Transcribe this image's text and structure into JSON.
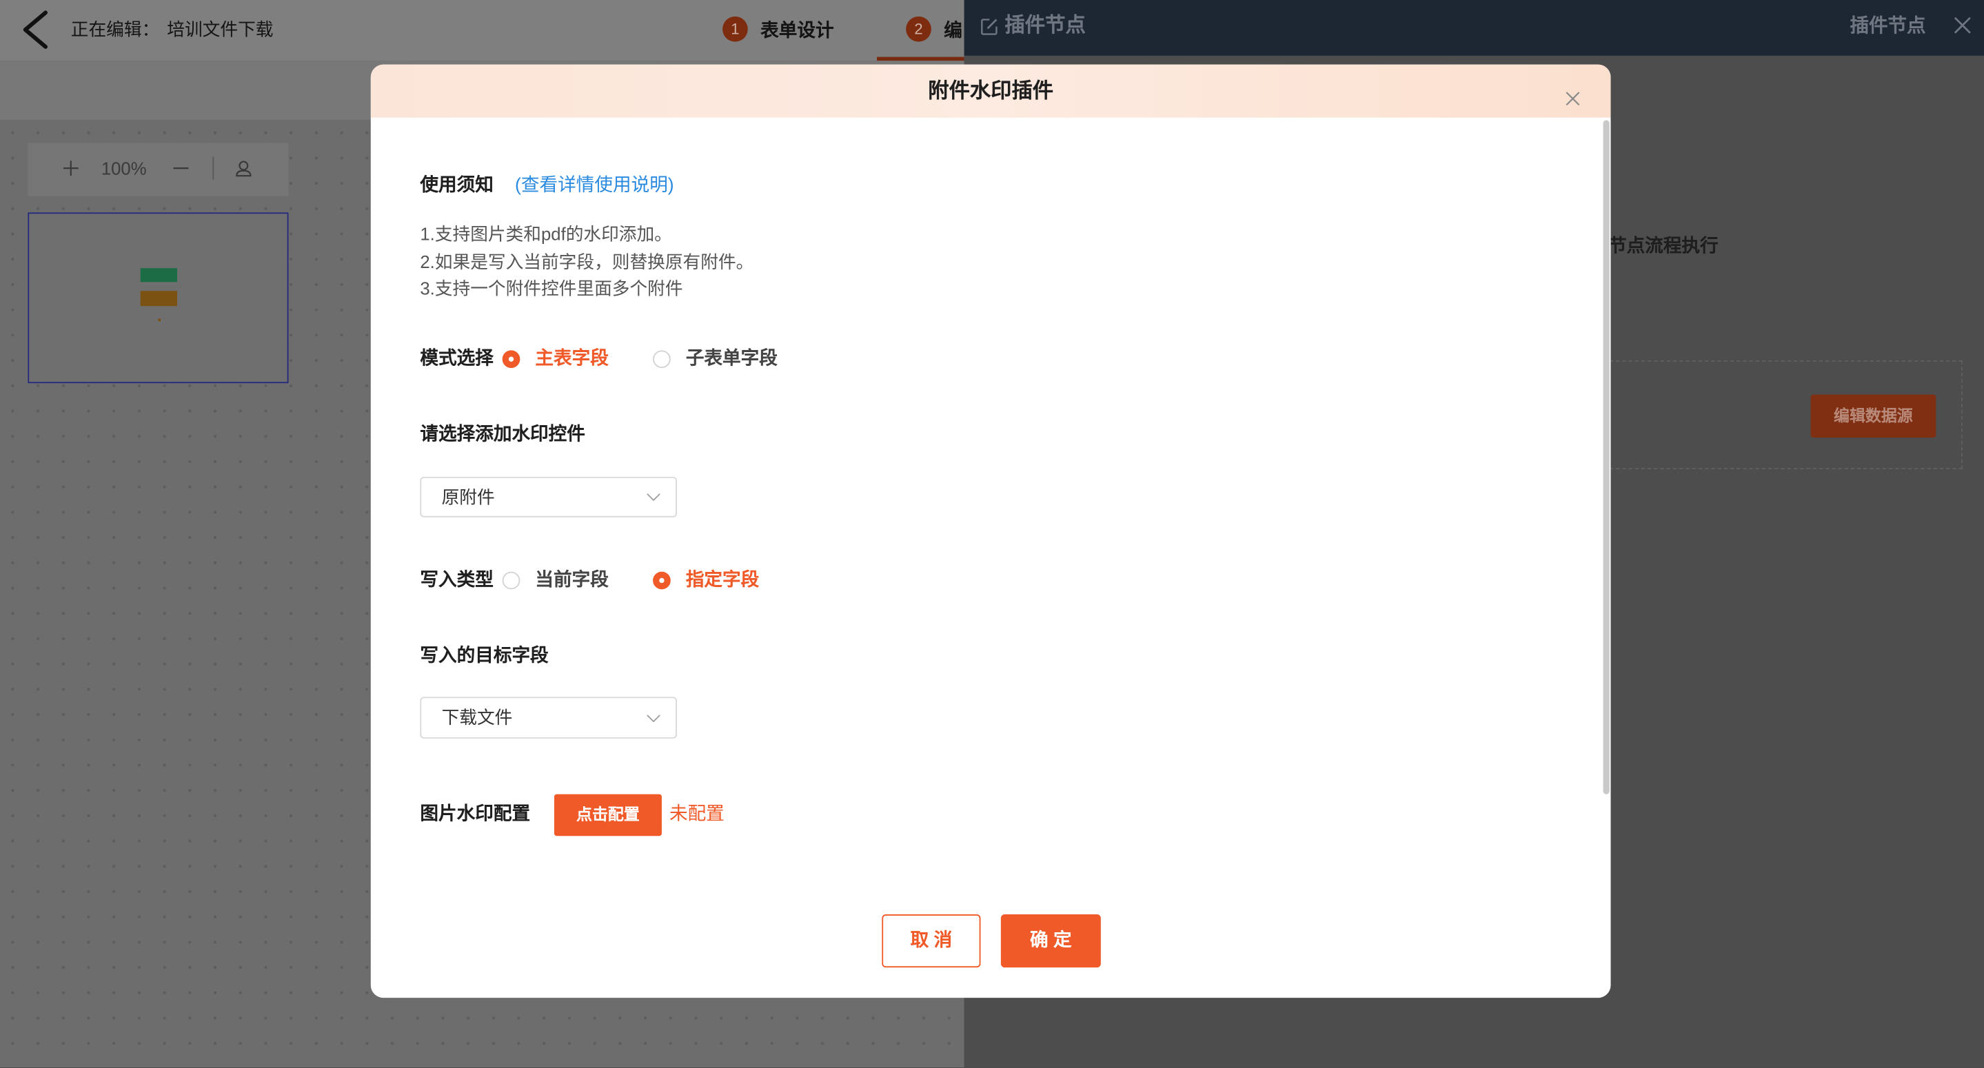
{
  "editor": {
    "editing_prefix": "正在编辑：",
    "document_name": "培训文件下载",
    "steps": [
      {
        "number": "1",
        "label": "表单设计"
      },
      {
        "number": "2",
        "label": "编"
      }
    ],
    "current_step": 2,
    "zoom_level": "100%"
  },
  "drawer": {
    "title": "插件节点",
    "header_right_label": "插件节点",
    "body_text": "节点流程执行",
    "edit_datasource_button": "编辑数据源"
  },
  "modal": {
    "title": "附件水印插件",
    "notice": {
      "label": "使用须知",
      "link": "(查看详情使用说明)",
      "items": [
        "1.支持图片类和pdf的水印添加。",
        "2.如果是写入当前字段，则替换原有附件。",
        "3.支持一个附件控件里面多个附件"
      ]
    },
    "mode": {
      "label": "模式选择",
      "options": [
        {
          "label": "主表字段",
          "selected": true
        },
        {
          "label": "子表单字段",
          "selected": false
        }
      ]
    },
    "source_control": {
      "label": "请选择添加水印控件",
      "value": "原附件"
    },
    "write_type": {
      "label": "写入类型",
      "options": [
        {
          "label": "当前字段",
          "selected": false
        },
        {
          "label": "指定字段",
          "selected": true
        }
      ]
    },
    "target_field": {
      "label": "写入的目标字段",
      "value": "下载文件"
    },
    "image_watermark": {
      "label": "图片水印配置",
      "button": "点击配置",
      "status": "未配置"
    },
    "footer": {
      "cancel": "取 消",
      "confirm": "确 定"
    }
  },
  "colors": {
    "accent": "#f05a28",
    "link": "#2a8ae0",
    "drawer_header": "#1d2734",
    "modal_header": "#fbe5d8"
  },
  "icons": {
    "back": "chevron-left-icon",
    "zoom_in": "plus-icon",
    "zoom_out": "minus-icon",
    "locate": "locate-user-icon",
    "drawer_edit": "edit-icon",
    "drawer_close": "close-icon",
    "modal_close": "close-icon",
    "select_arrow": "chevron-down-icon"
  }
}
